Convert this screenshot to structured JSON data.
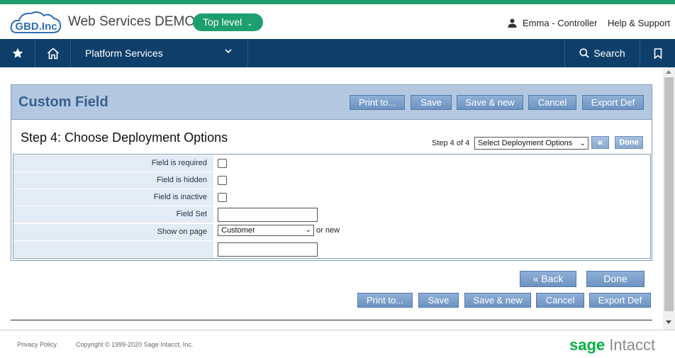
{
  "header": {
    "logo_text": "GBD.Inc",
    "app_title": "Web Services DEMO",
    "level_label": "Top level",
    "user_label": "Emma - Controller",
    "help_label": "Help & Support"
  },
  "nav": {
    "platform_label": "Platform Services",
    "search_label": "Search",
    "icons": [
      "star-icon",
      "home-icon",
      "chevron-down-icon",
      "search-icon",
      "bookmark-icon"
    ]
  },
  "card": {
    "title": "Custom Field",
    "toolbar": {
      "print": "Print to...",
      "save": "Save",
      "save_new": "Save & new",
      "cancel": "Cancel",
      "export": "Export Def"
    },
    "step_title": "Step 4: Choose Deployment Options",
    "step_label": "Step 4 of 4",
    "step_select_value": "Select Deployment Options",
    "back_small": "«",
    "done_small": "Done"
  },
  "form": {
    "rows": [
      {
        "label": "Field is required"
      },
      {
        "label": "Field is hidden"
      },
      {
        "label": "Field is inactive"
      },
      {
        "label": "Field Set"
      },
      {
        "label": "Show on page"
      },
      {
        "label": ""
      }
    ],
    "page_select_value": "Customer",
    "or_new": "or new"
  },
  "bottom": {
    "back": "« Back",
    "done": "Done",
    "print": "Print to...",
    "save": "Save",
    "save_new": "Save & new",
    "cancel": "Cancel",
    "export": "Export Def"
  },
  "footer": {
    "privacy": "Privacy Policy",
    "copyright": "Copyright © 1999-2020 Sage Intacct, Inc.",
    "brand_sage": "sage",
    "brand_intacct": "Intacct"
  },
  "colors": {
    "accent_green": "#1d9e6e",
    "nav_blue": "#0e3f6b",
    "header_band": "#b3c8e0",
    "button_blue": "#6c93c2"
  }
}
